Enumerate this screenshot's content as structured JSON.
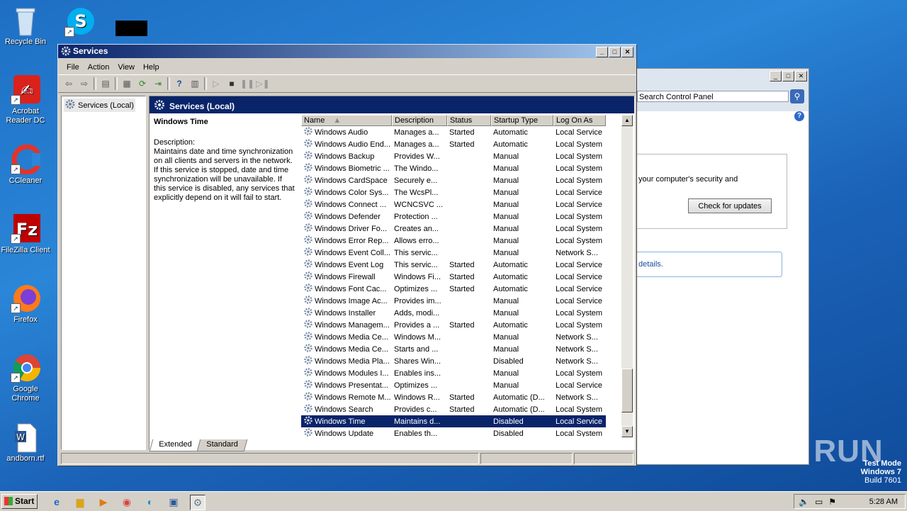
{
  "desktop": {
    "icons": [
      {
        "label": "Recycle Bin"
      },
      {
        "label": "Acrobat Reader DC"
      },
      {
        "label": "CCleaner"
      },
      {
        "label": "FileZilla Client"
      },
      {
        "label": "Firefox"
      },
      {
        "label": "Google Chrome"
      },
      {
        "label": "andborn.rtf"
      }
    ]
  },
  "control_panel": {
    "search_placeholder": "Search Control Panel",
    "security_text": "your computer's security and",
    "check_updates_label": "Check for updates",
    "details_text": "details."
  },
  "services_window": {
    "title": "Services",
    "menu": [
      "File",
      "Action",
      "View",
      "Help"
    ],
    "tree_item": "Services (Local)",
    "header_title": "Services (Local)",
    "selected_name": "Windows Time",
    "description_label": "Description:",
    "description": "Maintains date and time synchronization on all clients and servers in the network. If this service is stopped, date and time synchronization will be unavailable. If this service is disabled, any services that explicitly depend on it will fail to start.",
    "columns": [
      "Name",
      "Description",
      "Status",
      "Startup Type",
      "Log On As"
    ],
    "rows": [
      {
        "name": "Windows Audio",
        "desc": "Manages a...",
        "status": "Started",
        "startup": "Automatic",
        "logon": "Local Service"
      },
      {
        "name": "Windows Audio End...",
        "desc": "Manages a...",
        "status": "Started",
        "startup": "Automatic",
        "logon": "Local System"
      },
      {
        "name": "Windows Backup",
        "desc": "Provides W...",
        "status": "",
        "startup": "Manual",
        "logon": "Local System"
      },
      {
        "name": "Windows Biometric ...",
        "desc": "The Windo...",
        "status": "",
        "startup": "Manual",
        "logon": "Local System"
      },
      {
        "name": "Windows CardSpace",
        "desc": "Securely e...",
        "status": "",
        "startup": "Manual",
        "logon": "Local System"
      },
      {
        "name": "Windows Color Sys...",
        "desc": "The WcsPl...",
        "status": "",
        "startup": "Manual",
        "logon": "Local Service"
      },
      {
        "name": "Windows Connect ...",
        "desc": "WCNCSVC ...",
        "status": "",
        "startup": "Manual",
        "logon": "Local Service"
      },
      {
        "name": "Windows Defender",
        "desc": "Protection ...",
        "status": "",
        "startup": "Manual",
        "logon": "Local System"
      },
      {
        "name": "Windows Driver Fo...",
        "desc": "Creates an...",
        "status": "",
        "startup": "Manual",
        "logon": "Local System"
      },
      {
        "name": "Windows Error Rep...",
        "desc": "Allows erro...",
        "status": "",
        "startup": "Manual",
        "logon": "Local System"
      },
      {
        "name": "Windows Event Coll...",
        "desc": "This servic...",
        "status": "",
        "startup": "Manual",
        "logon": "Network S..."
      },
      {
        "name": "Windows Event Log",
        "desc": "This servic...",
        "status": "Started",
        "startup": "Automatic",
        "logon": "Local Service"
      },
      {
        "name": "Windows Firewall",
        "desc": "Windows Fi...",
        "status": "Started",
        "startup": "Automatic",
        "logon": "Local Service"
      },
      {
        "name": "Windows Font Cac...",
        "desc": "Optimizes ...",
        "status": "Started",
        "startup": "Automatic",
        "logon": "Local Service"
      },
      {
        "name": "Windows Image Ac...",
        "desc": "Provides im...",
        "status": "",
        "startup": "Manual",
        "logon": "Local Service"
      },
      {
        "name": "Windows Installer",
        "desc": "Adds, modi...",
        "status": "",
        "startup": "Manual",
        "logon": "Local System"
      },
      {
        "name": "Windows Managem...",
        "desc": "Provides a ...",
        "status": "Started",
        "startup": "Automatic",
        "logon": "Local System"
      },
      {
        "name": "Windows Media Ce...",
        "desc": "Windows M...",
        "status": "",
        "startup": "Manual",
        "logon": "Network S..."
      },
      {
        "name": "Windows Media Ce...",
        "desc": "Starts and ...",
        "status": "",
        "startup": "Manual",
        "logon": "Network S..."
      },
      {
        "name": "Windows Media Pla...",
        "desc": "Shares Win...",
        "status": "",
        "startup": "Disabled",
        "logon": "Network S..."
      },
      {
        "name": "Windows Modules I...",
        "desc": "Enables ins...",
        "status": "",
        "startup": "Manual",
        "logon": "Local System"
      },
      {
        "name": "Windows Presentat...",
        "desc": "Optimizes ...",
        "status": "",
        "startup": "Manual",
        "logon": "Local Service"
      },
      {
        "name": "Windows Remote M...",
        "desc": "Windows R...",
        "status": "Started",
        "startup": "Automatic (D...",
        "logon": "Network S..."
      },
      {
        "name": "Windows Search",
        "desc": "Provides c...",
        "status": "Started",
        "startup": "Automatic (D...",
        "logon": "Local System"
      },
      {
        "name": "Windows Time",
        "desc": "Maintains d...",
        "status": "",
        "startup": "Disabled",
        "logon": "Local Service",
        "selected": true
      },
      {
        "name": "Windows Update",
        "desc": "Enables th...",
        "status": "",
        "startup": "Disabled",
        "logon": "Local System"
      }
    ],
    "tabs": [
      "Extended",
      "Standard"
    ]
  },
  "taskbar": {
    "start_label": "Start",
    "clock": "5:28 AM"
  },
  "watermark": {
    "line1": "Test Mode",
    "line2": "Windows 7",
    "line3": "Build 7601",
    "brand": "ANY RUN"
  }
}
